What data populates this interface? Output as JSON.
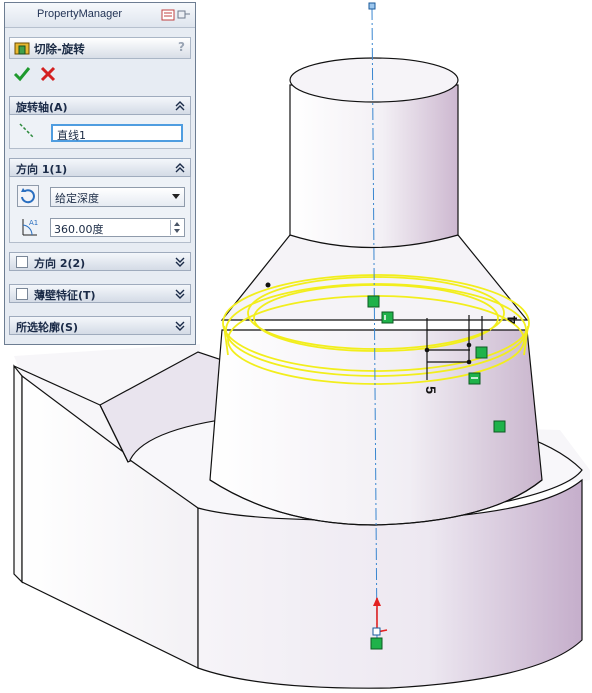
{
  "property_manager": {
    "title": "PropertyManager",
    "feature_title": "切除-旋转",
    "help_label": "?",
    "ok_icon": "check-icon",
    "cancel_icon": "close-icon",
    "groups": {
      "axis": {
        "label": "旋转轴(A)",
        "value": "直线1"
      },
      "direction1": {
        "label": "方向 1(1)",
        "end_condition": "给定深度",
        "angle": "360.00度"
      },
      "direction2": {
        "label": "方向 2(2)"
      },
      "thin_feature": {
        "label": "薄壁特征(T)"
      },
      "selected_contours": {
        "label": "所选轮廓(S)"
      }
    }
  },
  "sketch": {
    "dim_4": "4",
    "dim_5": "5"
  },
  "colors": {
    "panel_bg": "#e7ecf3",
    "selection_yellow": "#f2ee1c",
    "axis_blue": "#3a86d0",
    "relation_green": "#1fb24a",
    "model_face": "#ece7f1"
  }
}
